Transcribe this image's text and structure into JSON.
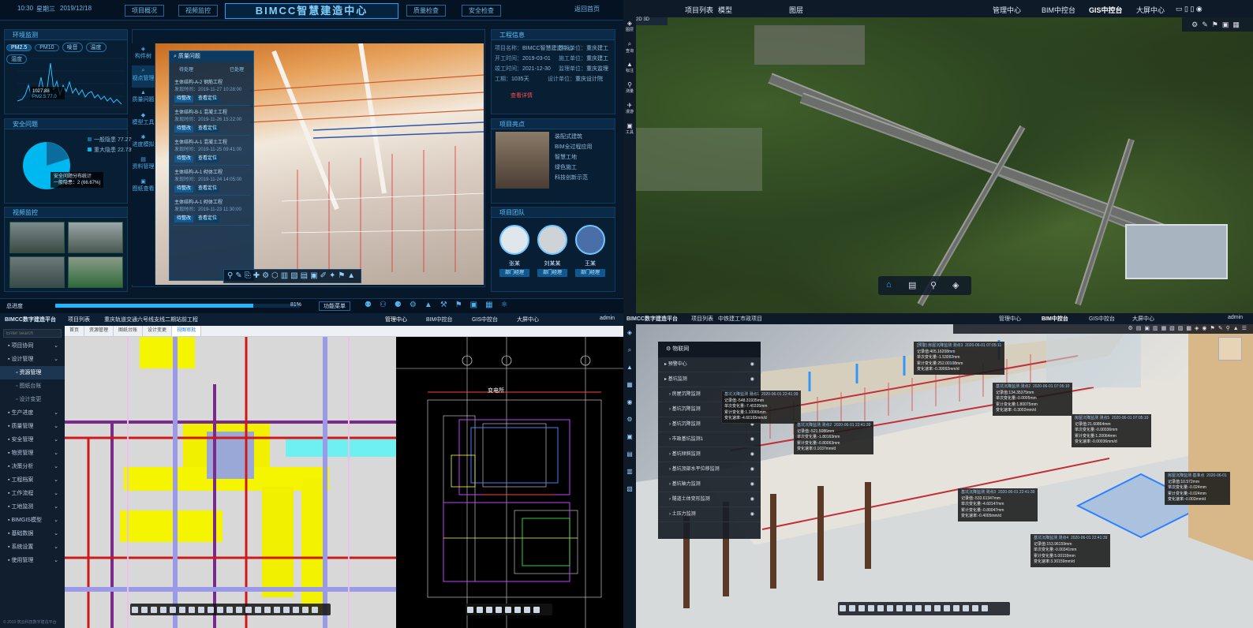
{
  "q1": {
    "time": "10:30",
    "weekday": "星期三",
    "date": "2019/12/18",
    "tabs_left": [
      "项目概况",
      "视频监控"
    ],
    "title": "BIMCC智慧建造中心",
    "tabs_right": [
      "质量检查",
      "安全检查"
    ],
    "right_label": "返回首页",
    "panel_env": "环境监测",
    "env_pills": [
      "PM2.5",
      "PM10",
      "噪音",
      "温度",
      "湿度"
    ],
    "env_values": [
      "1027.88",
      "PM2.5:77.0"
    ],
    "panel_safety": "安全问题",
    "safety_legend": [
      "一般隐患 77.27%",
      "重大隐患 22.73%"
    ],
    "safety_tip": [
      "安全问题分布统计",
      "一般隐患：2 (66.67%)"
    ],
    "panel_video": "视频监控",
    "nav_items": [
      "构件树",
      "视点管理",
      "质量问题",
      "模型工具",
      "进度模拟",
      "资料管理",
      "图纸查看"
    ],
    "list_title": "质量问题",
    "list_tabs": [
      "待处理",
      "已处理"
    ],
    "list_items": [
      {
        "title": "主体结构-A-2  钢筋工程",
        "date": "发现时间：2019-11-27 10:28:00",
        "chip1": "待整改",
        "chip2": "查看定位"
      },
      {
        "title": "主体结构-B-1  混凝土工程",
        "date": "发现时间：2019-11-26 15:22:00",
        "chip1": "待整改",
        "chip2": "查看定位"
      },
      {
        "title": "主体结构-A-1  混凝土工程",
        "date": "发现时间：2019-11-25 09:41:00",
        "chip1": "待整改",
        "chip2": "查看定位"
      },
      {
        "title": "主体结构-A-1  砌体工程",
        "date": "发现时间：2019-11-24 14:05:00",
        "chip1": "待整改",
        "chip2": "查看定位"
      },
      {
        "title": "主体结构-A-1  砌体工程",
        "date": "发现时间：2019-11-23 11:30:00",
        "chip1": "待整改",
        "chip2": "查看定位"
      }
    ],
    "panel_info": "工程信息",
    "info_rows": [
      [
        "项目名称：",
        "BIMCC智慧建造中心",
        "建设单位：",
        "重庆建工"
      ],
      [
        "开工时间：",
        "2019-03-01",
        "施工单位：",
        "重庆建工"
      ],
      [
        "竣工时间：",
        "2021-12-30",
        "监理单位：",
        "重庆监理"
      ],
      [
        "工期：",
        "1035天",
        "设计单位：",
        "重庆设计院"
      ]
    ],
    "info_link": "查看详情",
    "panel_progress": "项目亮点",
    "progress_rows": [
      "装配式建筑",
      "BIM全过程应用",
      "智慧工地",
      "绿色施工",
      "科技创新示范"
    ],
    "panel_team": "项目团队",
    "team": [
      {
        "name": "张某",
        "role": "部门经理"
      },
      {
        "name": "刘某某",
        "role": "部门经理"
      },
      {
        "name": "王某",
        "role": "部门经理"
      }
    ],
    "bottom_left": "总进度",
    "progress_pct": "81%",
    "progress_value": 0.81,
    "bottom_label": "功能菜单"
  },
  "q2": {
    "topbar": [
      "项目列表",
      "模型",
      "图层"
    ],
    "nav": [
      "管理中心",
      "BIM中控台",
      "GIS中控台",
      "大屏中心"
    ],
    "left_items": [
      "图层",
      "查询",
      "标注",
      "测量",
      "漫游",
      "工具"
    ],
    "view_tabs": [
      "2D",
      "3D"
    ]
  },
  "q3": {
    "brand": "BIMCC数字建造平台",
    "project_label": "项目列表",
    "project": "重庆轨道交通六号线支线二期站前工程",
    "nav": [
      "管理中心",
      "BIM中控台",
      "GIS中控台",
      "大屏中心"
    ],
    "user": "admin",
    "search_placeholder": "Enter search",
    "sidebar": [
      {
        "label": "项目协同",
        "sub": false
      },
      {
        "label": "设计管理",
        "sub": false
      },
      {
        "label": "资源管理",
        "sub": true
      },
      {
        "label": "图纸台账",
        "sub": true
      },
      {
        "label": "设计变更",
        "sub": true
      },
      {
        "label": "生产进度",
        "sub": false
      },
      {
        "label": "质量管理",
        "sub": false
      },
      {
        "label": "安全管理",
        "sub": false
      },
      {
        "label": "物资管理",
        "sub": false
      },
      {
        "label": "决策分析",
        "sub": false
      },
      {
        "label": "工程档案",
        "sub": false
      },
      {
        "label": "工作流程",
        "sub": false
      },
      {
        "label": "工地监测",
        "sub": false
      },
      {
        "label": "BIMGIS模型",
        "sub": false
      },
      {
        "label": "基础数据",
        "sub": false
      },
      {
        "label": "系统设置",
        "sub": false
      },
      {
        "label": "使用管理",
        "sub": false
      }
    ],
    "tabs": [
      "首页",
      "资源管理",
      "图纸台账",
      "设计变更",
      "视图审批"
    ],
    "footer": "© 2019 筑云科技数字建造平台",
    "cad_label": "变电所"
  },
  "q4": {
    "brand": "BIMCC数字建造平台",
    "project_label": "项目列表",
    "project": "中铁建工市政项目",
    "nav": [
      "管理中心",
      "BIM中控台",
      "GIS中控台",
      "大屏中心"
    ],
    "user": "admin",
    "tree_title": "物联网",
    "tree": [
      {
        "label": "预警中心",
        "sub": false
      },
      {
        "label": "基坑监测",
        "sub": false
      },
      {
        "label": "房屋沉降监测",
        "sub": true
      },
      {
        "label": "基坑沉降监测",
        "sub": true
      },
      {
        "label": "基坑沉降监测",
        "sub": true
      },
      {
        "label": "市政基坑监测1",
        "sub": true
      },
      {
        "label": "基坑倾斜监测",
        "sub": true
      },
      {
        "label": "基坑顶部水平位移监测",
        "sub": true
      },
      {
        "label": "基坑轴力监测",
        "sub": true
      },
      {
        "label": "隧道土体变形监测",
        "sub": true
      },
      {
        "label": "土压力监测",
        "sub": true
      }
    ],
    "tags": [
      {
        "t": "[预警] 房屋沉降监测 测点3",
        "d": "2020-06-01 07:05:11",
        "l": [
          "记录值:405.16208mm",
          "单次变化量:-1.53092mm",
          "累计变化量:252.00108mm",
          "变化速率:-0.39992mm/d"
        ]
      },
      {
        "t": "基坑沉降监测 测点1",
        "d": "2020-06-01 22:41:39",
        "l": [
          "记录值:-548.31935mm",
          "单次变化量:-7.40335mm",
          "累计变化量:1.10065mm",
          "变化速率:-4.60165mm/d"
        ]
      },
      {
        "t": "基坑沉降监测 测点2",
        "d": "2020-06-01 07:05:10",
        "l": [
          "记录值:134.35375mm",
          "单次变化量:-0.0005mm",
          "累计变化量:1.80075mm",
          "变化速率:-0.3002mm/d"
        ]
      },
      {
        "t": "基坑沉降监测 测点2",
        "d": "2020-06-01 22:41:39",
        "l": [
          "记录值:-521.5086mm",
          "单次变化量:-1.80163mm",
          "累计变化量:-0.80063mm",
          "变化速率:0.1037mm/d"
        ]
      },
      {
        "t": "房屋沉降监测 测点5",
        "d": "2020-06-01 07:05:10",
        "l": [
          "记录值:21.60864mm",
          "单次变化量:-0.00036mm",
          "累计变化量:1.20064mm",
          "变化速率:-0.00036mm/d"
        ]
      },
      {
        "t": "基坑沉降监测 测点3",
        "d": "2020-06-01 22:41:39",
        "l": [
          "记录值:-533.61347mm",
          "单次变化量:-4.60147mm",
          "累计变化量:-0.80047mm",
          "变化速率:-0.4005mm/d"
        ]
      },
      {
        "t": "房屋沉降监测 基准点",
        "d": "2020-06-01",
        "l": [
          "记录值:10.572mm",
          "单次变化量:-0.024mm",
          "累计变化量:-0.024mm",
          "变化速率:-0.003mm/d"
        ]
      },
      {
        "t": "基坑沉降监测 测点4",
        "d": "2020-06-01 22:41:39",
        "l": [
          "记录值:153.96159mm",
          "单次变化量:-0.00341mm",
          "累计变化量:5.00159mm",
          "变化速率:3.30159mm/d"
        ]
      }
    ]
  }
}
